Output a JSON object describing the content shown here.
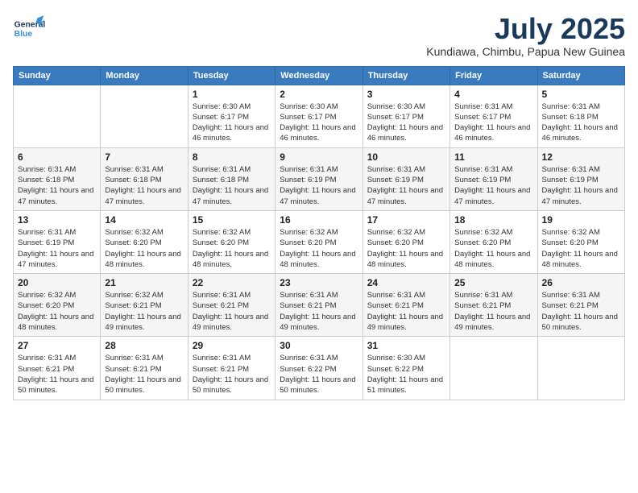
{
  "header": {
    "logo_general": "General",
    "logo_blue": "Blue",
    "month_year": "July 2025",
    "location": "Kundiawa, Chimbu, Papua New Guinea"
  },
  "columns": [
    "Sunday",
    "Monday",
    "Tuesday",
    "Wednesday",
    "Thursday",
    "Friday",
    "Saturday"
  ],
  "weeks": [
    [
      {
        "day": "",
        "info": ""
      },
      {
        "day": "",
        "info": ""
      },
      {
        "day": "1",
        "info": "Sunrise: 6:30 AM\nSunset: 6:17 PM\nDaylight: 11 hours and 46 minutes."
      },
      {
        "day": "2",
        "info": "Sunrise: 6:30 AM\nSunset: 6:17 PM\nDaylight: 11 hours and 46 minutes."
      },
      {
        "day": "3",
        "info": "Sunrise: 6:30 AM\nSunset: 6:17 PM\nDaylight: 11 hours and 46 minutes."
      },
      {
        "day": "4",
        "info": "Sunrise: 6:31 AM\nSunset: 6:17 PM\nDaylight: 11 hours and 46 minutes."
      },
      {
        "day": "5",
        "info": "Sunrise: 6:31 AM\nSunset: 6:18 PM\nDaylight: 11 hours and 46 minutes."
      }
    ],
    [
      {
        "day": "6",
        "info": "Sunrise: 6:31 AM\nSunset: 6:18 PM\nDaylight: 11 hours and 47 minutes."
      },
      {
        "day": "7",
        "info": "Sunrise: 6:31 AM\nSunset: 6:18 PM\nDaylight: 11 hours and 47 minutes."
      },
      {
        "day": "8",
        "info": "Sunrise: 6:31 AM\nSunset: 6:18 PM\nDaylight: 11 hours and 47 minutes."
      },
      {
        "day": "9",
        "info": "Sunrise: 6:31 AM\nSunset: 6:19 PM\nDaylight: 11 hours and 47 minutes."
      },
      {
        "day": "10",
        "info": "Sunrise: 6:31 AM\nSunset: 6:19 PM\nDaylight: 11 hours and 47 minutes."
      },
      {
        "day": "11",
        "info": "Sunrise: 6:31 AM\nSunset: 6:19 PM\nDaylight: 11 hours and 47 minutes."
      },
      {
        "day": "12",
        "info": "Sunrise: 6:31 AM\nSunset: 6:19 PM\nDaylight: 11 hours and 47 minutes."
      }
    ],
    [
      {
        "day": "13",
        "info": "Sunrise: 6:31 AM\nSunset: 6:19 PM\nDaylight: 11 hours and 47 minutes."
      },
      {
        "day": "14",
        "info": "Sunrise: 6:32 AM\nSunset: 6:20 PM\nDaylight: 11 hours and 48 minutes."
      },
      {
        "day": "15",
        "info": "Sunrise: 6:32 AM\nSunset: 6:20 PM\nDaylight: 11 hours and 48 minutes."
      },
      {
        "day": "16",
        "info": "Sunrise: 6:32 AM\nSunset: 6:20 PM\nDaylight: 11 hours and 48 minutes."
      },
      {
        "day": "17",
        "info": "Sunrise: 6:32 AM\nSunset: 6:20 PM\nDaylight: 11 hours and 48 minutes."
      },
      {
        "day": "18",
        "info": "Sunrise: 6:32 AM\nSunset: 6:20 PM\nDaylight: 11 hours and 48 minutes."
      },
      {
        "day": "19",
        "info": "Sunrise: 6:32 AM\nSunset: 6:20 PM\nDaylight: 11 hours and 48 minutes."
      }
    ],
    [
      {
        "day": "20",
        "info": "Sunrise: 6:32 AM\nSunset: 6:20 PM\nDaylight: 11 hours and 48 minutes."
      },
      {
        "day": "21",
        "info": "Sunrise: 6:32 AM\nSunset: 6:21 PM\nDaylight: 11 hours and 49 minutes."
      },
      {
        "day": "22",
        "info": "Sunrise: 6:31 AM\nSunset: 6:21 PM\nDaylight: 11 hours and 49 minutes."
      },
      {
        "day": "23",
        "info": "Sunrise: 6:31 AM\nSunset: 6:21 PM\nDaylight: 11 hours and 49 minutes."
      },
      {
        "day": "24",
        "info": "Sunrise: 6:31 AM\nSunset: 6:21 PM\nDaylight: 11 hours and 49 minutes."
      },
      {
        "day": "25",
        "info": "Sunrise: 6:31 AM\nSunset: 6:21 PM\nDaylight: 11 hours and 49 minutes."
      },
      {
        "day": "26",
        "info": "Sunrise: 6:31 AM\nSunset: 6:21 PM\nDaylight: 11 hours and 50 minutes."
      }
    ],
    [
      {
        "day": "27",
        "info": "Sunrise: 6:31 AM\nSunset: 6:21 PM\nDaylight: 11 hours and 50 minutes."
      },
      {
        "day": "28",
        "info": "Sunrise: 6:31 AM\nSunset: 6:21 PM\nDaylight: 11 hours and 50 minutes."
      },
      {
        "day": "29",
        "info": "Sunrise: 6:31 AM\nSunset: 6:21 PM\nDaylight: 11 hours and 50 minutes."
      },
      {
        "day": "30",
        "info": "Sunrise: 6:31 AM\nSunset: 6:22 PM\nDaylight: 11 hours and 50 minutes."
      },
      {
        "day": "31",
        "info": "Sunrise: 6:30 AM\nSunset: 6:22 PM\nDaylight: 11 hours and 51 minutes."
      },
      {
        "day": "",
        "info": ""
      },
      {
        "day": "",
        "info": ""
      }
    ]
  ]
}
